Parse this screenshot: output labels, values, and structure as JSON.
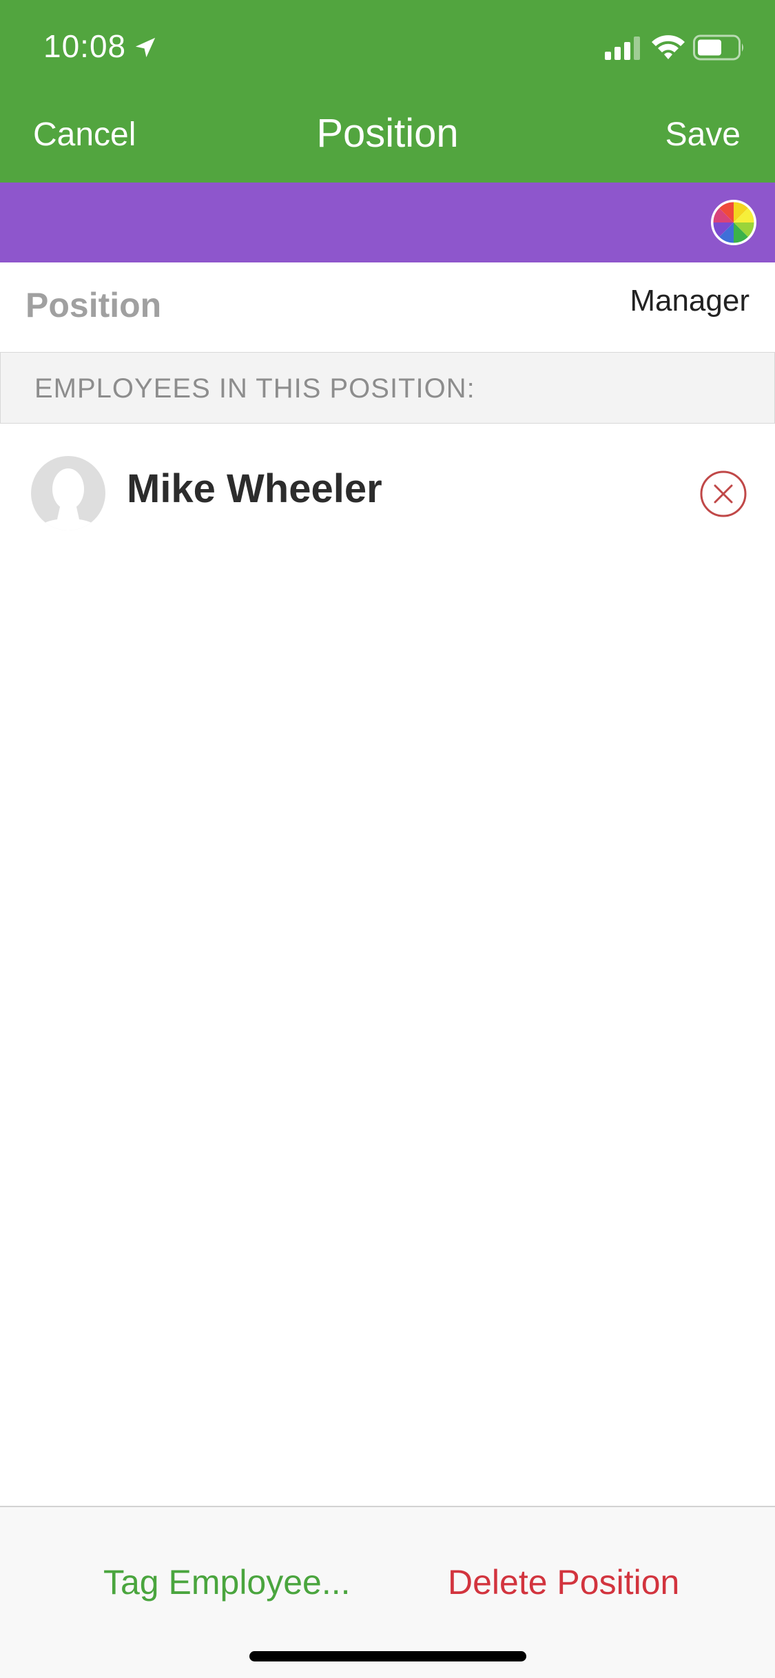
{
  "status_bar": {
    "time": "10:08",
    "location_icon": "location-arrow-icon",
    "signal_icon": "cellular-signal-icon",
    "wifi_icon": "wifi-icon",
    "battery_icon": "battery-icon"
  },
  "nav": {
    "cancel_label": "Cancel",
    "title": "Position",
    "save_label": "Save"
  },
  "colors": {
    "header": "#52a53f",
    "position_color": "#8e56cc",
    "tag_button": "#4aa53e",
    "delete_button": "#d2343e",
    "remove_icon": "#c04848"
  },
  "position_field": {
    "label": "Position",
    "value": "Manager"
  },
  "employees_section": {
    "header": "EMPLOYEES IN THIS POSITION:",
    "employees": [
      {
        "name": "Mike Wheeler",
        "avatar_icon": "default-avatar-icon"
      }
    ]
  },
  "bottom_bar": {
    "tag_label": "Tag Employee...",
    "delete_label": "Delete Position"
  }
}
